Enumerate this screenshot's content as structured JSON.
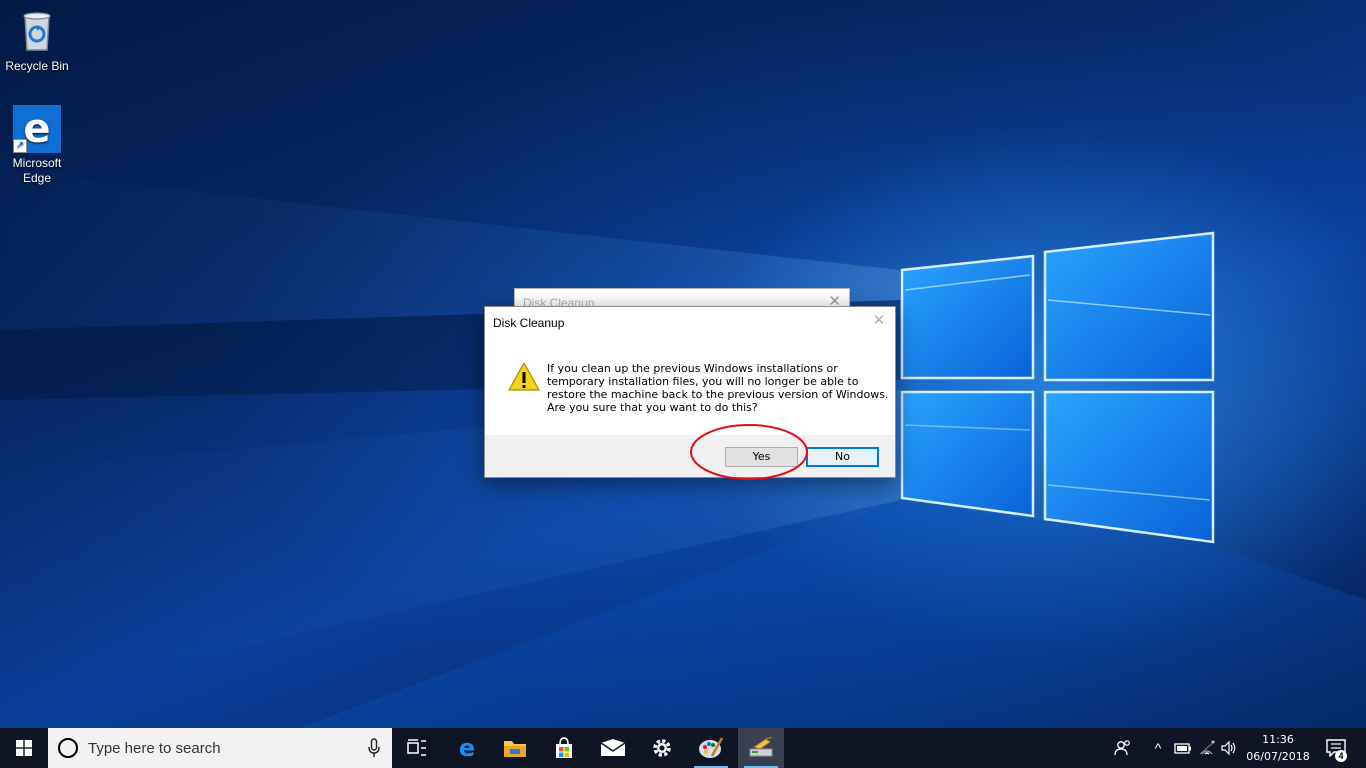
{
  "desktop": {
    "icons": [
      {
        "label": "Recycle Bin",
        "icon": "recycle-bin-icon"
      },
      {
        "label": "Microsoft Edge",
        "label_lines": [
          "Microsoft",
          "Edge"
        ],
        "icon": "edge-icon"
      }
    ]
  },
  "background_dialog": {
    "title": "Disk Cleanup",
    "close_glyph": "✕"
  },
  "dialog": {
    "title": "Disk Cleanup",
    "close_glyph": "✕",
    "icon": "warning-icon",
    "message_lines": [
      "If you clean up the previous Windows installations or",
      "temporary installation files, you will no longer be able to",
      "restore the machine back to the previous version of Windows.",
      "Are you sure that you want to do this?"
    ],
    "buttons": {
      "yes": "Yes",
      "no": "No"
    },
    "focused_button": "No",
    "annotation": "red-ellipse-around-yes"
  },
  "taskbar": {
    "search_placeholder": "Type here to search",
    "pinned": [
      {
        "name": "task-view-icon"
      },
      {
        "name": "edge-icon"
      },
      {
        "name": "file-explorer-icon"
      },
      {
        "name": "store-icon"
      },
      {
        "name": "mail-icon"
      },
      {
        "name": "settings-icon"
      },
      {
        "name": "paint-icon"
      },
      {
        "name": "disk-cleanup-icon",
        "active": true
      }
    ],
    "tray": {
      "people": "people-icon",
      "chevron": "^",
      "battery": "battery-icon",
      "wifi": "wifi-icon",
      "volume": "volume-icon"
    },
    "clock": {
      "time": "11:36",
      "date": "06/07/2018"
    },
    "notification_count": "4"
  },
  "colors": {
    "accent": "#0078d7",
    "annotation": "#e0101a",
    "taskbar": "#101523"
  }
}
